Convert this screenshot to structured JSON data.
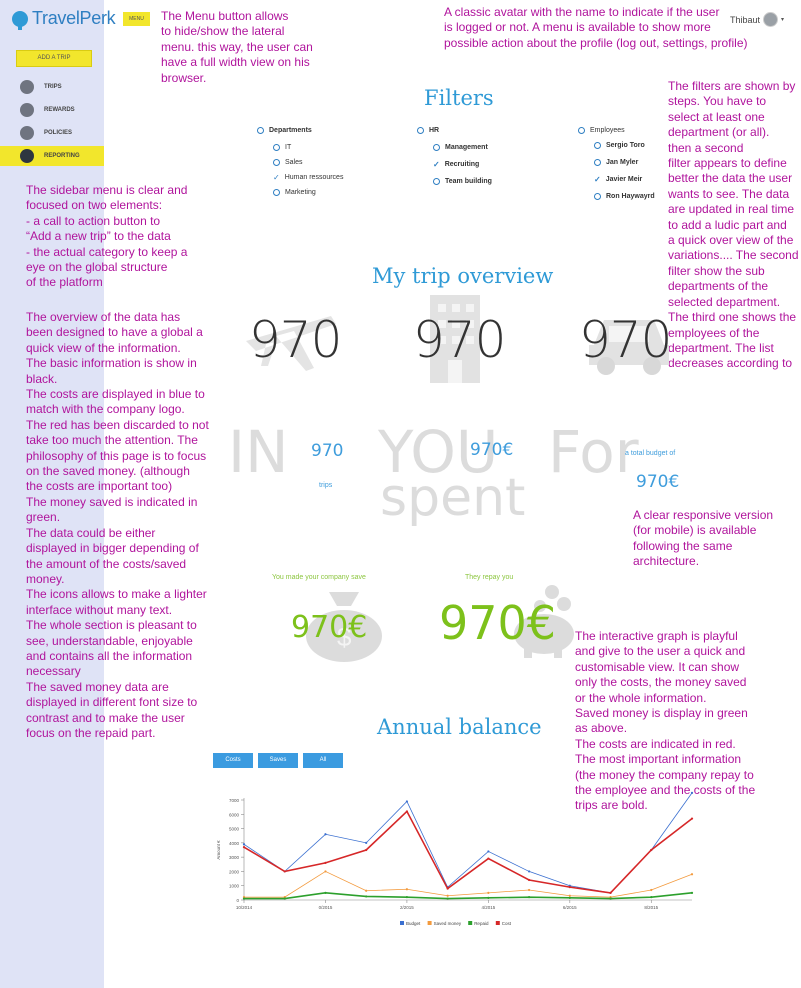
{
  "app": {
    "brand": "TravelPerk",
    "brand_color": "#2f7fc2",
    "accent": "#f2e62c"
  },
  "sidebar": {
    "add_trip": "ADD A TRIP",
    "items": [
      {
        "label": "TRIPS",
        "icon": "trips-icon",
        "active": false
      },
      {
        "label": "REWARDS",
        "icon": "rewards-icon",
        "active": false
      },
      {
        "label": "POLICIES",
        "icon": "policies-icon",
        "active": false
      },
      {
        "label": "REPORTING",
        "icon": "reporting-icon",
        "active": true
      }
    ]
  },
  "header": {
    "menu_label": "MENU",
    "user_name": "Thibaut"
  },
  "annotations": {
    "menu": "The Menu button allows\nto hide/show the lateral\nmenu. this way, the user can\nhave a full width view on his\nbrowser.",
    "avatar": "A classic avatar with the name to indicate if the user\nis logged or not. A menu is available to show more\npossible action about the profile (log out, settings, profile)",
    "filters": "The filters are shown by\nsteps. You have to\nselect at least one\ndepartment (or all).\nthen a second\nfilter appears to define\nbetter the data the user\nwants to see. The data\nare updated in real time\nto add a ludic part and\na quick over view of the\nvariations.... The second\nfilter show the sub\ndepartments of the\nselected department.\nThe third one shows the\nemployees of the\ndepartment. The list\ndecreases according to",
    "sidebar": "The sidebar menu is clear and\nfocused on two elements:\n- a call to action button to\n“Add a new trip” to the data\n- the actual category to keep a\neye on the global structure\nof the platform",
    "overview": "The overview of the data has\nbeen designed to have a global a\nquick view of the information.\nThe basic information is show in\nblack.\nThe costs are displayed in blue to\nmatch with the company logo.\nThe red has been discarded to not\ntake too much the attention. The\nphilosophy of this page is to focus\non the saved money. (although\nthe costs are important too)\nThe money saved is indicated in\ngreen.\nThe data could be either\ndisplayed in bigger depending of\nthe amount of the costs/saved\nmoney.\nThe icons allows to make a lighter\ninterface without many text.\nThe whole section is pleasant to\nsee, understandable, enjoyable\nand contains all the information\nnecessary\nThe saved money data are\ndisplayed in different font size to\ncontrast and to make the user\nfocus on the repaid part.",
    "responsive": "A clear responsive version\n(for mobile) is available\nfollowing the same\narchitecture.",
    "graph": "The interactive graph is playful\nand give to the user a quick and\ncustomisable view. It can show\nonly the costs, the money saved\nor the whole information.\nSaved money is display in green\nas above.\nThe costs are indicated in red.\nThe most important information\n(the money the company repay to\nthe employee and the costs of the\ntrips are bold."
  },
  "filters": {
    "title": "Filters",
    "col1": {
      "header": "Departments",
      "items": [
        "IT",
        "Sales",
        "Human ressources",
        "Marketing"
      ],
      "checked": [
        false,
        false,
        true,
        false
      ]
    },
    "col2": {
      "header": "HR",
      "items": [
        "Management",
        "Recruiting",
        "Team building"
      ],
      "checked": [
        false,
        true,
        false
      ]
    },
    "col3": {
      "header": "Employees",
      "items": [
        "Sergio Toro",
        "Jan Myler",
        "Javier Meir",
        "Ron Haywayrd"
      ],
      "checked": [
        false,
        false,
        true,
        false
      ]
    }
  },
  "overview": {
    "title": "My trip overview",
    "stats": [
      "970",
      "970",
      "970"
    ],
    "ghost_words": {
      "in": "IN",
      "you": "YOU",
      "for": "For",
      "spent": "spent"
    },
    "trips_value": "970",
    "trips_label": "trips",
    "spent_value": "970€",
    "budget_label": "a total budget of",
    "budget_value": "970€",
    "save_label": "You made your company save",
    "save_value": "970€",
    "repay_label": "They repay you",
    "repay_value": "970€"
  },
  "graph": {
    "title": "Annual balance",
    "tabs": [
      "Costs",
      "Saves",
      "All"
    ]
  },
  "chart_data": {
    "type": "line",
    "ylabel": "Amount €",
    "ylim": [
      0,
      7000
    ],
    "yticks": [
      0,
      1000,
      2000,
      3000,
      4000,
      5000,
      6000,
      7000
    ],
    "x_tick_labels": [
      "10/2014",
      "0/2015",
      "2/2015",
      "4/2015",
      "6/2015",
      "8/2015"
    ],
    "series": [
      {
        "name": "Budget",
        "color": "#3a6fd0",
        "values": [
          3900,
          2000,
          4600,
          4000,
          6900,
          900,
          3400,
          2000,
          1000,
          500,
          3500,
          7500
        ]
      },
      {
        "name": "Saved money",
        "color": "#f39a3d",
        "values": [
          200,
          200,
          2000,
          650,
          750,
          300,
          500,
          700,
          300,
          200,
          700,
          1800
        ]
      },
      {
        "name": "Repaid",
        "color": "#2ca02c",
        "values": [
          100,
          100,
          500,
          250,
          200,
          100,
          150,
          200,
          150,
          100,
          200,
          500
        ]
      },
      {
        "name": "Cost",
        "color": "#d62728",
        "values": [
          3700,
          2000,
          2600,
          3500,
          6200,
          800,
          2900,
          1400,
          900,
          500,
          3500,
          5700
        ]
      }
    ]
  }
}
